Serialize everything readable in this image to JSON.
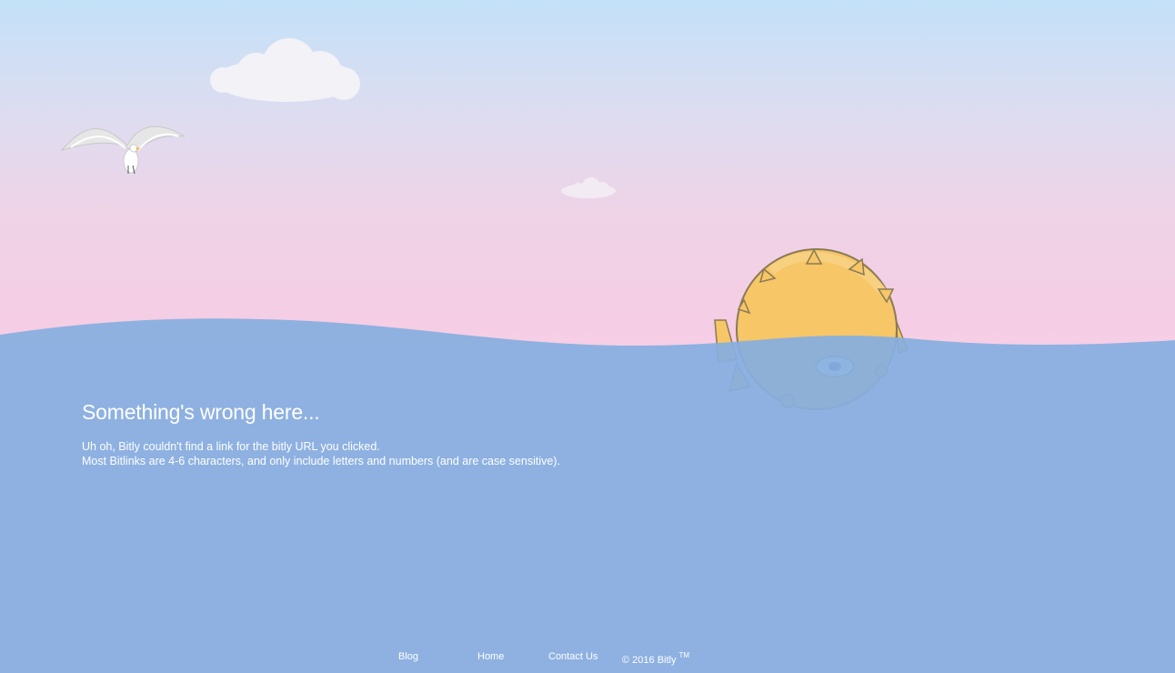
{
  "main": {
    "headline": "Something's wrong here...",
    "message_line1": "Uh oh, Bitly couldn't find a link for the bitly URL you clicked.",
    "message_line2": "Most Bitlinks are 4-6 characters, and only include letters and numbers (and are case sensitive)."
  },
  "footer": {
    "links": [
      {
        "label": "Blog"
      },
      {
        "label": "Home"
      },
      {
        "label": "Contact Us"
      }
    ],
    "copyright": "© 2016 Bitly",
    "trademark": "TM"
  },
  "colors": {
    "sky_top": "#c3e1f8",
    "sky_bottom": "#f6cee6",
    "sea": "#85aee0",
    "fish_body": "#f6c667",
    "text": "#ffffff"
  },
  "illustrations": [
    "cloud",
    "seagull",
    "pufferfish"
  ]
}
